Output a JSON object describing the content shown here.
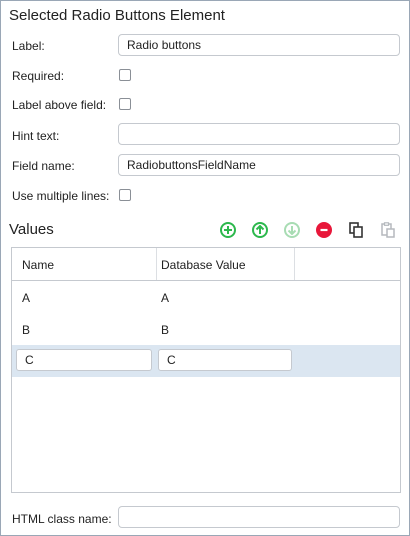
{
  "panel": {
    "title": "Selected Radio Buttons Element"
  },
  "form": {
    "label": {
      "caption": "Label:",
      "value": "Radio buttons"
    },
    "required": {
      "caption": "Required:",
      "checked": false
    },
    "label_above": {
      "caption": "Label above field:",
      "checked": false
    },
    "hint": {
      "caption": "Hint text:",
      "value": ""
    },
    "field_name": {
      "caption": "Field name:",
      "value": "RadiobuttonsFieldName"
    },
    "multiline": {
      "caption": "Use multiple lines:",
      "checked": false
    },
    "html_class": {
      "caption": "HTML class name:",
      "value": ""
    }
  },
  "values": {
    "title": "Values",
    "toolbar": [
      {
        "icon": "add-icon",
        "color": "#2db84d",
        "enabled": true
      },
      {
        "icon": "move-up-icon",
        "color": "#2db84d",
        "enabled": true
      },
      {
        "icon": "move-down-icon",
        "color": "#a8dcb3",
        "enabled": false
      },
      {
        "icon": "delete-icon",
        "color": "#e8173a",
        "enabled": true
      },
      {
        "icon": "copy-icon",
        "color": "#333333",
        "enabled": true
      },
      {
        "icon": "paste-icon",
        "color": "#b5b9be",
        "enabled": false
      }
    ],
    "columns": [
      "Name",
      "Database Value"
    ],
    "rows": [
      {
        "name": "A",
        "value": "A"
      },
      {
        "name": "B",
        "value": "B"
      },
      {
        "name": "C",
        "value": "C",
        "editing": true
      }
    ]
  }
}
